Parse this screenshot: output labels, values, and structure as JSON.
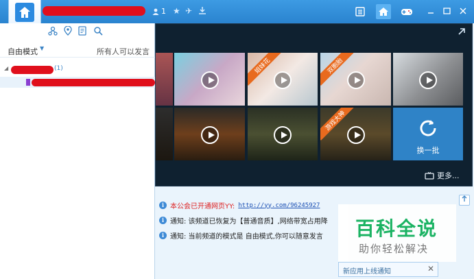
{
  "titlebar": {
    "user_count": "1",
    "accent": "#2a83cf"
  },
  "logo": {
    "sub_label": "↑↓"
  },
  "left": {
    "mode_label": "自由模式",
    "mode_right": "所有人可以发言",
    "channel_count": "(1)"
  },
  "video_panel": {
    "thumbs": [
      {
        "ribbon": ""
      },
      {
        "ribbon": "姐妹花"
      },
      {
        "ribbon": "双胞胎"
      },
      {
        "ribbon": ""
      },
      {
        "ribbon": ""
      },
      {
        "ribbon": ""
      },
      {
        "ribbon": "游戏大神"
      }
    ],
    "refresh_label": "换一批",
    "more_label": "更多..."
  },
  "messages": [
    {
      "text": "本公会已开通网页YY:",
      "link": "http://yy.com/96245927",
      "color": "#d22"
    },
    {
      "text": "通知: 该频道已恢复为【普通音质】,网络带宽占用降",
      "link": "",
      "color": "#222"
    },
    {
      "text": "通知: 当前频道的模式是 自由模式,你可以随意发言",
      "link": "",
      "color": "#222"
    }
  ],
  "watermark": {
    "title": "百科全说",
    "subtitle": "助你轻松解决"
  },
  "popup": {
    "title": "新应用上线通知"
  }
}
